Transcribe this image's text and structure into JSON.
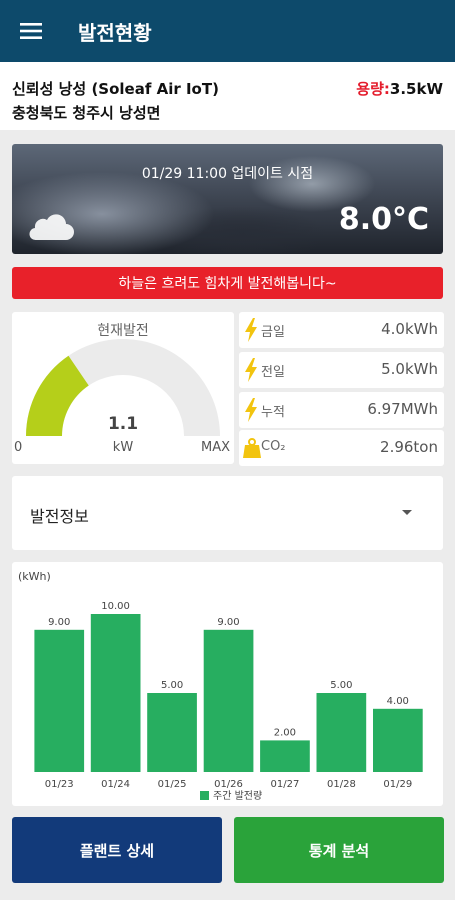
{
  "app_bar": {
    "title": "발전현황",
    "menu_icon": "hamburger-menu-icon"
  },
  "plant": {
    "name": "신뢰성 낭성 (Soleaf Air IoT)",
    "address": "충청북도 청주시 낭성면",
    "capacity_label": "용량:",
    "capacity_value": "3.5kW"
  },
  "weather": {
    "update_text": "01/29 11:00 업데이트 시점",
    "temperature": "8.0°C",
    "icon": "cloud-icon"
  },
  "banner": {
    "message": "하늘은 흐려도 힘차게 발전해봅니다~",
    "color": "#e8212a"
  },
  "current_generation": {
    "title": "현재발전",
    "value": "1.1",
    "unit": "kW",
    "min_label": "0",
    "max_label": "MAX",
    "fraction_of_max": 0.31,
    "fill_color": "#b5cf1a"
  },
  "stats": [
    {
      "label": "금일",
      "value": "4.0kWh",
      "icon": "lightning-icon"
    },
    {
      "label": "전일",
      "value": "5.0kWh",
      "icon": "lightning-icon"
    },
    {
      "label": "누적",
      "value": "6.97MWh",
      "icon": "lightning-icon"
    },
    {
      "label": "CO₂",
      "value": "2.96ton",
      "icon": "co2-weight-icon"
    }
  ],
  "info_select": {
    "selected": "발전정보",
    "icon": "dropdown-arrow-icon"
  },
  "chart_data": {
    "type": "bar",
    "ylabel": "(kWh)",
    "categories": [
      "01/23",
      "01/24",
      "01/25",
      "01/26",
      "01/27",
      "01/28",
      "01/29"
    ],
    "series": [
      {
        "name": "주간 발전량",
        "values": [
          9.0,
          10.0,
          5.0,
          9.0,
          2.0,
          5.0,
          4.0
        ],
        "color": "#27ae60"
      }
    ],
    "data_labels": [
      "9.00",
      "10.00",
      "5.00",
      "9.00",
      "2.00",
      "5.00",
      "4.00"
    ],
    "ylim": [
      0,
      10
    ],
    "grid": false,
    "legend": "bottom-center"
  },
  "buttons": {
    "plant_detail": "플랜트 상세",
    "statistics": "통계 분석"
  },
  "colors": {
    "app_bar": "#0d4a6b",
    "capacity_label": "#e41c2c",
    "detail_button": "#123a7a",
    "stats_button": "#2aa33a"
  }
}
